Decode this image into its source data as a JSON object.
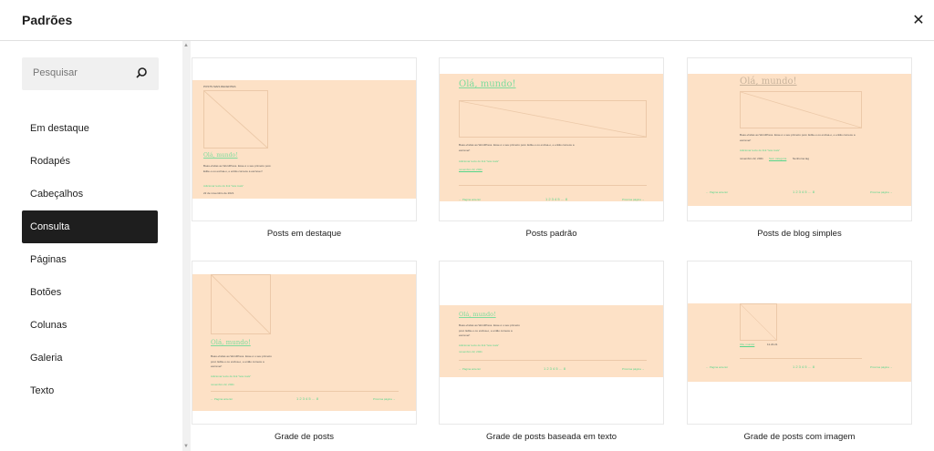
{
  "header": {
    "title": "Padrões",
    "close_icon": "close-icon"
  },
  "sidebar": {
    "search_placeholder": "Pesquisar",
    "items": [
      {
        "label": "Em destaque"
      },
      {
        "label": "Rodapés"
      },
      {
        "label": "Cabeçalhos"
      },
      {
        "label": "Consulta",
        "active": true
      },
      {
        "label": "Páginas"
      },
      {
        "label": "Botões"
      },
      {
        "label": "Colunas"
      },
      {
        "label": "Galeria"
      },
      {
        "label": "Texto"
      }
    ]
  },
  "thumb": {
    "recent": "POSTS MAIS RECENTES",
    "post_title": "Olá, mundo!",
    "excerpt": "Boas-vindas ao WordPress. Esse é o seu primeiro post. Edite-o ou exclua-o, e então comece a escrever!",
    "read_more": "Adicionar texto do link \"leia mais\"",
    "date_long": "22 de novembro de 2021",
    "date": "novembro 22, 2021",
    "category": "Sem categoria",
    "tags": "Nenhuma tag",
    "prev": "← Página anterior",
    "pages": "1 2 3 4 5 … 8",
    "next": "Próxima página →",
    "date_short": "11.22.21"
  },
  "patterns": [
    {
      "label": "Posts em destaque"
    },
    {
      "label": "Posts padrão"
    },
    {
      "label": "Posts de blog simples"
    },
    {
      "label": "Grade de posts"
    },
    {
      "label": "Grade de posts baseada em texto"
    },
    {
      "label": "Grade de posts com imagem"
    }
  ],
  "colors": {
    "accent": "#1e1e1e",
    "thumb_bg": "#fde1c6",
    "link": "#55d68a"
  }
}
